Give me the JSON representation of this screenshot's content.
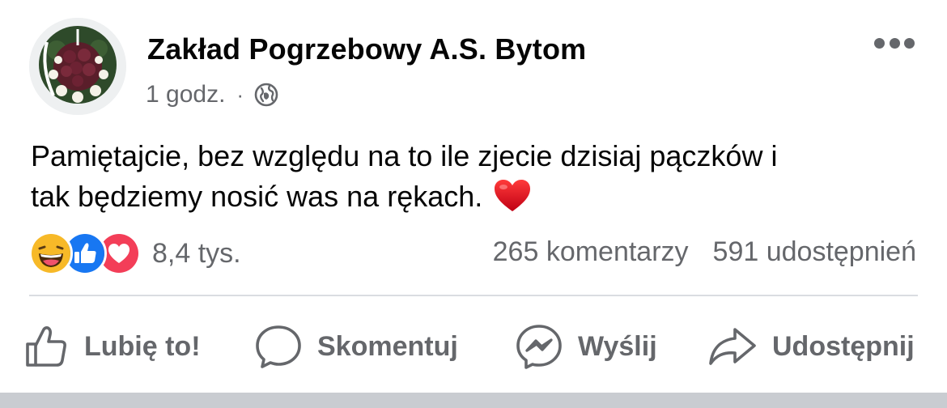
{
  "post": {
    "author": "Zakład Pogrzebowy A.S. Bytom",
    "time": "1 godz.",
    "separator": "·",
    "privacy_icon": "globe-icon",
    "more_icon": "ellipsis-icon",
    "text_line1": "Pamiętajcie, bez względu na to ile zjecie dzisiaj pączków i",
    "text_line2": "tak będziemy nosić was na rękach.",
    "text_emoji": "red-heart"
  },
  "reactions": {
    "icons": [
      "haha-icon",
      "like-icon",
      "love-icon"
    ],
    "count": "8,4 tys.",
    "comments": "265 komentarzy",
    "shares": "591 udostępnień"
  },
  "actions": {
    "like": "Lubię to!",
    "comment": "Skomentuj",
    "send": "Wyślij",
    "share": "Udostępnij"
  },
  "colors": {
    "text": "#050505",
    "secondary": "#65676b",
    "like_blue": "#1877f2",
    "love_red": "#f33e58",
    "haha_yellow": "#f7b928",
    "divider": "#dadde1",
    "heart": "#d0021b"
  }
}
